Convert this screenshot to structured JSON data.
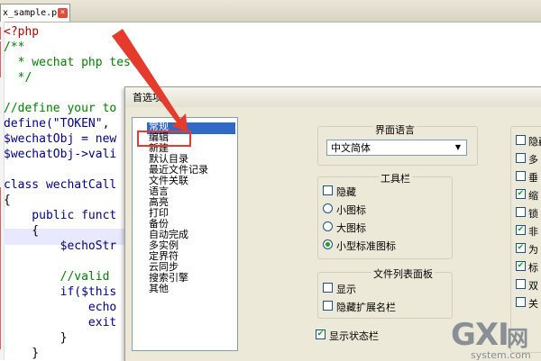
{
  "editor": {
    "tab_label": "x_sample.php",
    "tab_close": "×",
    "lines": [
      {
        "text": "<?php"
      },
      {
        "text": "/**"
      },
      {
        "text": "  * wechat php test"
      },
      {
        "text": "  */"
      },
      {
        "text": ""
      },
      {
        "text": "//define your to"
      },
      {
        "text": "define(\"TOKEN\","
      },
      {
        "text": "$wechatObj = new"
      },
      {
        "text": "$wechatObj->vali"
      },
      {
        "text": ""
      },
      {
        "text": "class wechatCall"
      },
      {
        "text": "{"
      },
      {
        "text": "    public funct"
      },
      {
        "text": "    {"
      },
      {
        "text": "        $echoStr"
      },
      {
        "text": ""
      },
      {
        "text": "        //valid"
      },
      {
        "text": "        if($this"
      },
      {
        "text": "            echo"
      },
      {
        "text": "            exit"
      },
      {
        "text": "        }"
      },
      {
        "text": "    }"
      }
    ]
  },
  "dialog": {
    "title": "首选项",
    "categories": [
      "常规",
      "编辑",
      "新建",
      "默认目录",
      "最近文件记录",
      "文件关联",
      "语言",
      "高亮",
      "打印",
      "备份",
      "自动完成",
      "多实例",
      "定界符",
      "云同步",
      "搜索引擎",
      "其他"
    ],
    "selected_category": "常规",
    "ui_language": {
      "heading": "界面语言",
      "value": "中文简体"
    },
    "toolbar": {
      "heading": "工具栏",
      "hide": "隐藏",
      "small_icons": "小图标",
      "large_icons": "大图标",
      "small_standard_icons": "小型标准图标"
    },
    "doclist": {
      "heading": "文件列表面板",
      "show": "显示",
      "hide_ext": "隐藏扩展名栏"
    },
    "status_bar": "显示状态栏",
    "right_col": [
      "隐藏",
      "多",
      "垂",
      "缩",
      "锁",
      "非",
      "为",
      "标",
      "双",
      "关"
    ],
    "right_checked": [
      false,
      false,
      false,
      true,
      false,
      true,
      true,
      true,
      false,
      false
    ]
  },
  "watermark": {
    "main_g": "G",
    "main_x": "X",
    "main_i": "I",
    "cn": "网",
    "sub": "system.com"
  },
  "colors": {
    "accent": "#3169c6",
    "highlight_red": "#e53b2c"
  }
}
